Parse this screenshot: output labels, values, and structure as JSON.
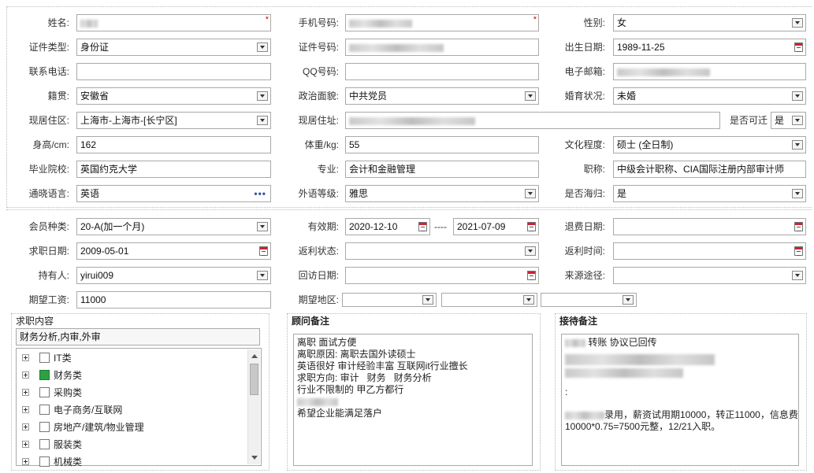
{
  "personal": {
    "name_label": "姓名:",
    "mobile_label": "手机号码:",
    "gender_label": "性别:",
    "gender_value": "女",
    "id_type_label": "证件类型:",
    "id_type_value": "身份证",
    "id_no_label": "证件号码:",
    "birth_label": "出生日期:",
    "birth_value": "1989-11-25",
    "phone_label": "联系电话:",
    "qq_label": "QQ号码:",
    "email_label": "电子邮箱:",
    "native_label": "籍贯:",
    "native_value": "安徽省",
    "political_label": "政治面貌:",
    "political_value": "中共党员",
    "marital_label": "婚育状况:",
    "marital_value": "未婚",
    "residence_area_label": "现居住区:",
    "residence_area_value": "上海市-上海市-[长宁区]",
    "residence_addr_label": "现居住址:",
    "relocate_label": "是否可迁",
    "relocate_value": "是",
    "height_label": "身高/cm:",
    "height_value": "162",
    "weight_label": "体重/kg:",
    "weight_value": "55",
    "education_label": "文化程度:",
    "education_value": "硕士 (全日制)",
    "school_label": "毕业院校:",
    "school_value": "英国约克大学",
    "major_label": "专业:",
    "major_value": "会计和金融管理",
    "title_label": "职称:",
    "title_value": "中级会计职称、CIA国际注册内部审计师",
    "language_label": "通晓语言:",
    "language_value": "英语",
    "language_level_label": "外语等级:",
    "language_level_value": "雅思",
    "returnee_label": "是否海归:",
    "returnee_value": "是",
    "required_mark": "*",
    "more_dots": "•••"
  },
  "membership": {
    "member_type_label": "会员种类:",
    "member_type_value": "20-A(加一个月)",
    "valid_label": "有效期:",
    "valid_from": "2020-12-10",
    "valid_sep": "----",
    "valid_to": "2021-07-09",
    "refund_label": "退费日期:",
    "job_date_label": "求职日期:",
    "job_date_value": "2009-05-01",
    "rebate_status_label": "返利状态:",
    "rebate_time_label": "返利时间:",
    "holder_label": "持有人:",
    "holder_value": "yirui009",
    "visit_label": "回访日期:",
    "source_label": "来源途径:",
    "salary_label": "期望工资:",
    "salary_value": "11000",
    "region_label": "期望地区:"
  },
  "job_content": {
    "title": "求职内容",
    "summary": "财务分析,内审,外审",
    "categories": [
      {
        "label": "IT类",
        "checked": false
      },
      {
        "label": "财务类",
        "checked": true
      },
      {
        "label": "采购类",
        "checked": false
      },
      {
        "label": "电子商务/互联网",
        "checked": false
      },
      {
        "label": "房地产/建筑/物业管理",
        "checked": false
      },
      {
        "label": "服装类",
        "checked": false
      },
      {
        "label": "机械类",
        "checked": false
      }
    ]
  },
  "consultant_notes": {
    "title": "顾问备注",
    "lines": [
      "离职 面试方便",
      "离职原因: 离职去国外读硕士",
      "英语很好 审计经验丰富 互联网it行业擅长",
      "求职方向: 审计   财务   财务分析",
      "行业不限制的 甲乙方都行",
      "",
      "希望企业能满足落户"
    ]
  },
  "reception_notes": {
    "title": "接待备注",
    "line1": "转账 协议已回传",
    "line2": ":",
    "line3": "录用，薪资试用期10000，转正11000，信息费",
    "line4": "10000*0.75=7500元整，12/21入职。"
  }
}
